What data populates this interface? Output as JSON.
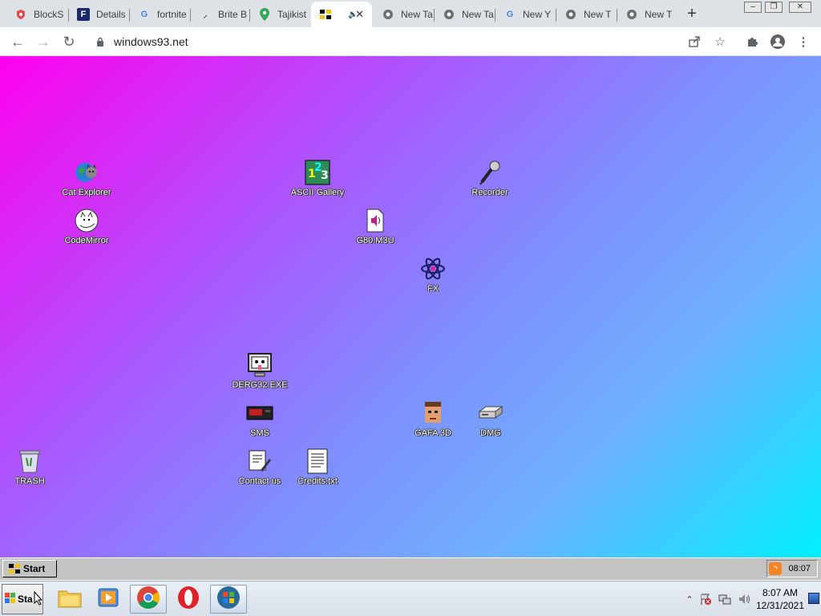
{
  "tabs": [
    {
      "title": "BlockS",
      "icon": "blocksite-shield-icon",
      "color": "#e04b4b"
    },
    {
      "title": "Details",
      "icon": "fandom-icon",
      "color": "#1a2a6c"
    },
    {
      "title": "fortnite",
      "icon": "google-icon",
      "color": "#4285f4"
    },
    {
      "title": "Brite B",
      "icon": "page-icon",
      "color": "#555555"
    },
    {
      "title": "Tajikist",
      "icon": "maps-pin-icon",
      "color": "#ea4335"
    },
    {
      "title": "",
      "icon": "win93-icon",
      "color": "#000000",
      "active": true
    },
    {
      "title": "New Ta",
      "icon": "chrome-icon",
      "color": "#5f6368"
    },
    {
      "title": "New Ta",
      "icon": "chrome-icon",
      "color": "#5f6368"
    },
    {
      "title": "New Y",
      "icon": "google-icon",
      "color": "#4285f4"
    },
    {
      "title": "New T",
      "icon": "chrome-icon",
      "color": "#5f6368"
    },
    {
      "title": "New T",
      "icon": "chrome-icon",
      "color": "#5f6368"
    }
  ],
  "toolbar": {
    "url": "windows93.net",
    "back": "←",
    "forward": "→",
    "reload": "↻",
    "new_tab": "+",
    "window_min": "–",
    "window_max": "❐",
    "window_close": "✕"
  },
  "desktop": {
    "icons": [
      {
        "label": "Cat Explorer",
        "icon": "cat-explorer-icon"
      },
      {
        "label": "ASCII Gallery",
        "icon": "ascii-gallery-icon"
      },
      {
        "label": "Recorder",
        "icon": "microphone-icon"
      },
      {
        "label": "CodeMirror",
        "icon": "codemirror-cat-icon"
      },
      {
        "label": "G80.M3U",
        "icon": "audio-file-icon"
      },
      {
        "label": "FX",
        "icon": "atom-icon"
      },
      {
        "label": "DERG32.EXE",
        "icon": "derg-monitor-icon"
      },
      {
        "label": "SMS",
        "icon": "sms-console-icon"
      },
      {
        "label": "GAFA 3D",
        "icon": "gafa-face-icon"
      },
      {
        "label": "DMG",
        "icon": "dmg-drive-icon"
      },
      {
        "label": "TRASH",
        "icon": "trash-icon"
      },
      {
        "label": "Contact us",
        "icon": "contact-edit-icon"
      },
      {
        "label": "Credits.txt",
        "icon": "text-file-icon"
      }
    ]
  },
  "w93_taskbar": {
    "start_label": "Start",
    "tray_time": "08:07"
  },
  "os_taskbar": {
    "start_label": "Sta",
    "clock_time": "8:07 AM",
    "clock_date": "12/31/2021",
    "pinned": [
      "file-explorer-icon",
      "media-player-icon",
      "chrome-icon",
      "opera-icon",
      "windows-logo-icon"
    ]
  }
}
